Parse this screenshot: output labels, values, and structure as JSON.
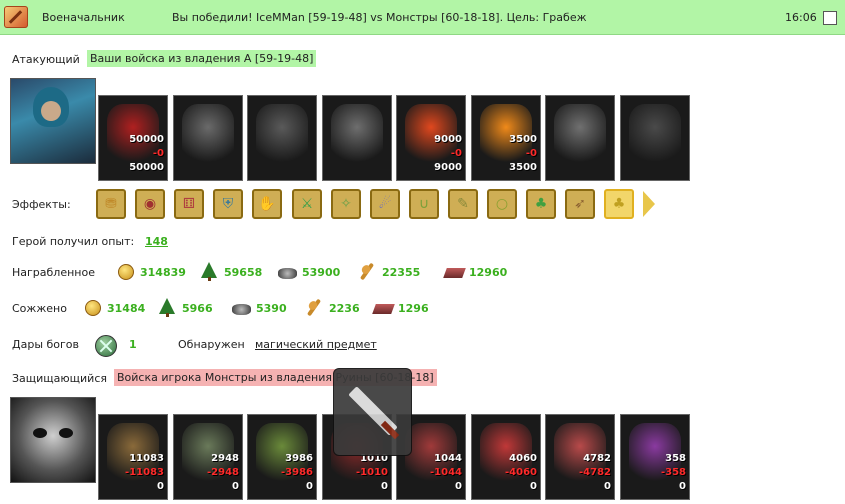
{
  "titlebar": {
    "name": "Военачальник",
    "message": "Вы победили! IceMMan [59-19-48] vs Монстры [60-18-18]. Цель: Грабеж",
    "time": "16:06"
  },
  "attacker": {
    "label": "Атакующий",
    "tag": "Ваши войска из владения А [59-19-48]",
    "units": [
      {
        "count": "50000",
        "loss": "-0",
        "remain": "50000",
        "color": "#b02020"
      },
      {
        "count": "",
        "loss": "",
        "remain": "",
        "color": "#6a6a6a"
      },
      {
        "count": "",
        "loss": "",
        "remain": "",
        "color": "#5a5a5a"
      },
      {
        "count": "",
        "loss": "",
        "remain": "",
        "color": "#6e6e6e"
      },
      {
        "count": "9000",
        "loss": "-0",
        "remain": "9000",
        "color": "#e0481e"
      },
      {
        "count": "3500",
        "loss": "-0",
        "remain": "3500",
        "color": "#f08a1a"
      },
      {
        "count": "",
        "loss": "",
        "remain": "",
        "color": "#707070"
      },
      {
        "count": "",
        "loss": "",
        "remain": "",
        "color": "#4a4a4a"
      }
    ]
  },
  "effects": {
    "label": "Эффекты:",
    "icons": [
      "coins-effect-icon",
      "eye-effect-icon",
      "dice-effect-icon",
      "shield-effect-icon",
      "hand-shield-effect-icon",
      "sword-effect-icon",
      "handshake-effect-icon",
      "hand-effect-icon",
      "boot-effect-icon",
      "scroll-effect-icon",
      "ring-effect-icon",
      "clover-effect-icon",
      "bow-effect-icon",
      "clover-gold-effect-icon"
    ]
  },
  "experience": {
    "label": "Герой получил опыт:",
    "value": "148"
  },
  "plundered": {
    "label": "Награбленное",
    "items": [
      {
        "icon": "gold-icon",
        "value": "314839"
      },
      {
        "icon": "wood-icon",
        "value": "59658"
      },
      {
        "icon": "ore-icon",
        "value": "53900"
      },
      {
        "icon": "grain-icon",
        "value": "22355"
      },
      {
        "icon": "stone-icon",
        "value": "12960"
      }
    ]
  },
  "burned": {
    "label": "Сожжено",
    "items": [
      {
        "icon": "gold-icon",
        "value": "31484"
      },
      {
        "icon": "wood-icon",
        "value": "5966"
      },
      {
        "icon": "ore-icon",
        "value": "5390"
      },
      {
        "icon": "grain-icon",
        "value": "2236"
      },
      {
        "icon": "stone-icon",
        "value": "1296"
      }
    ]
  },
  "gifts": {
    "label": "Дары богов",
    "value": "1",
    "found_label": "Обнаружен",
    "found_link": "магический предмет"
  },
  "defender": {
    "label": "Защищающийся",
    "tag": "Войска игрока Монстры из владения Руины [60-18-18]",
    "units": [
      {
        "count": "11083",
        "loss": "-11083",
        "remain": "0",
        "color": "#8a6a3a"
      },
      {
        "count": "2948",
        "loss": "-2948",
        "remain": "0",
        "color": "#6a7a5a"
      },
      {
        "count": "3986",
        "loss": "-3986",
        "remain": "0",
        "color": "#6a8a3a"
      },
      {
        "count": "1010",
        "loss": "-1010",
        "remain": "0",
        "color": "#8a2a2a"
      },
      {
        "count": "1044",
        "loss": "-1044",
        "remain": "0",
        "color": "#a03a3a"
      },
      {
        "count": "4060",
        "loss": "-4060",
        "remain": "0",
        "color": "#c03838"
      },
      {
        "count": "4782",
        "loss": "-4782",
        "remain": "0",
        "color": "#b84a4a"
      },
      {
        "count": "358",
        "loss": "-358",
        "remain": "0",
        "color": "#8a3aa0"
      }
    ]
  }
}
